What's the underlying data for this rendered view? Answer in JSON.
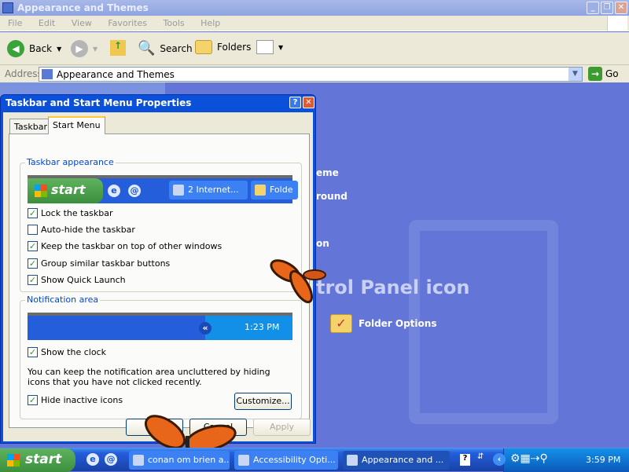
{
  "window": {
    "title": "Appearance and Themes",
    "controls": [
      "minimize",
      "restore",
      "close"
    ]
  },
  "menu": [
    "File",
    "Edit",
    "View",
    "Favorites",
    "Tools",
    "Help"
  ],
  "toolbar": {
    "back": "Back",
    "search": "Search",
    "folders": "Folders"
  },
  "address": {
    "label": "Address",
    "value": "Appearance and Themes",
    "go": "Go"
  },
  "content": {
    "partial_items": [
      "eme",
      "round",
      "on"
    ],
    "heading": "trol Panel icon",
    "folder_options": "Folder Options"
  },
  "dialog": {
    "title": "Taskbar and Start Menu Properties",
    "tabs": [
      {
        "label": "Taskbar"
      },
      {
        "label": "Start Menu",
        "active": true
      }
    ],
    "taskbar_group": {
      "label": "Taskbar appearance",
      "preview": {
        "start": "start",
        "button1": "2 Internet...",
        "button2": "Folde"
      },
      "options": [
        {
          "label": "Lock the taskbar",
          "checked": true
        },
        {
          "label": "Auto-hide the taskbar",
          "checked": false
        },
        {
          "label": "Keep the taskbar on top of other windows",
          "checked": true
        },
        {
          "label": "Group similar taskbar buttons",
          "checked": true
        },
        {
          "label": "Show Quick Launch",
          "checked": true
        }
      ]
    },
    "notification_group": {
      "label": "Notification area",
      "preview_time": "1:23 PM",
      "show_clock": {
        "label": "Show the clock",
        "checked": true
      },
      "description": "You can keep the notification area uncluttered by hiding icons that you have not clicked recently.",
      "hide_inactive": {
        "label": "Hide inactive icons",
        "checked": true
      },
      "customize": "Customize..."
    },
    "buttons": {
      "ok": "OK",
      "cancel": "Cancel",
      "apply": "Apply"
    }
  },
  "taskbar": {
    "start": "start",
    "tasks": [
      {
        "label": "conan om brien a..."
      },
      {
        "label": "Accessibility Opti..."
      },
      {
        "label": "Appearance and ...",
        "active": true
      }
    ],
    "clock": "3:59 PM"
  },
  "colors": {
    "desktop_blue": "#6375d6",
    "taskbar_blue": "#245edb",
    "start_green": "#3c8f3c",
    "butterfly": "#e8661a"
  }
}
